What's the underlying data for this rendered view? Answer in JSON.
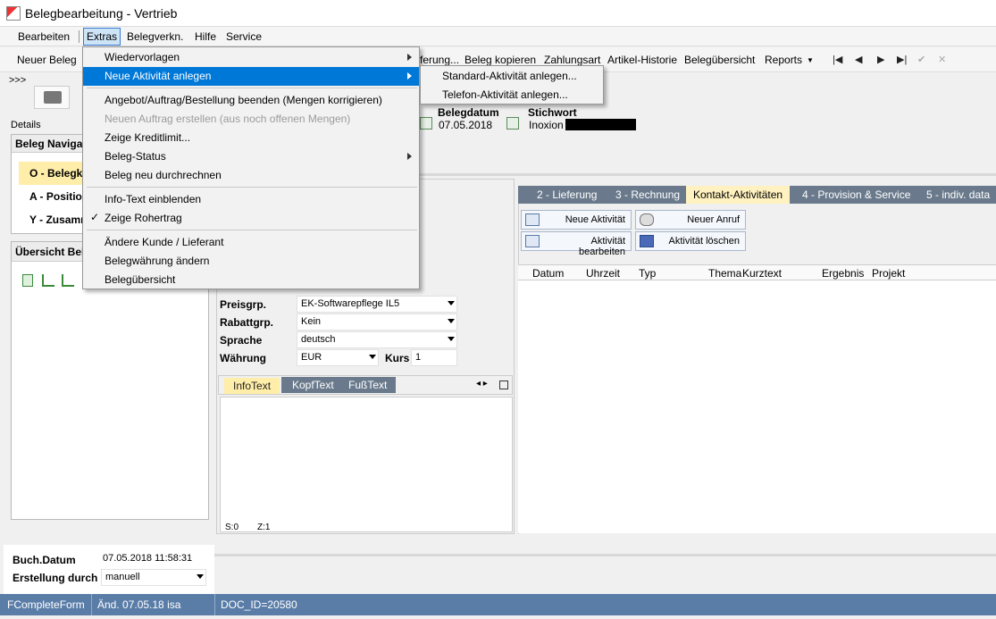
{
  "window": {
    "title": "Belegbearbeitung - Vertrieb"
  },
  "menubar": {
    "items": [
      "Bearbeiten",
      "Extras",
      "Belegverkn.",
      "Hilfe",
      "Service"
    ]
  },
  "toolbar": {
    "new_doc": "Neuer Beleg",
    "items_right": [
      "ferung...",
      "Beleg kopieren",
      "Zahlungsart",
      "Artikel-Historie",
      "Belegübersicht",
      "Reports"
    ],
    "nav": [
      "|◀",
      "◀",
      "▶",
      "▶|",
      "✔",
      "✕"
    ]
  },
  "left": {
    "expander": ">>>",
    "details_label": "Details",
    "nav_header": "Beleg Navigat",
    "nav_items": [
      "O - Belegk",
      "A - Position",
      "Y - Zusamı"
    ],
    "overview_header": "Übersicht Bel"
  },
  "header_fields": {
    "date_label": "Belegdatum",
    "date_value": "07.05.2018",
    "keyword_label": "Stichwort",
    "keyword_value": "Inoxion"
  },
  "tabs": [
    "2 - Lieferung",
    "3 - Rechnung",
    "Kontakt-Aktivitäten",
    "4 - Provision & Service",
    "5 - indiv. data"
  ],
  "activity_buttons": {
    "new_activity": "Neue Aktivität",
    "new_call": "Neuer Anruf",
    "edit_activity": "Aktivität bearbeiten",
    "delete_activity": "Aktivität löschen"
  },
  "grid_columns": [
    "Datum",
    "Uhrzeit",
    "Typ",
    "Thema",
    "Kurztext",
    "Ergebnis",
    "Projekt"
  ],
  "form": {
    "price_group_label": "Preisgrp.",
    "price_group_value": "EK-Softwarepflege IL5",
    "discount_label": "Rabattgrp.",
    "discount_value": "Kein",
    "language_label": "Sprache",
    "language_value": "deutsch",
    "currency_label": "Währung",
    "currency_value": "EUR",
    "rate_label": "Kurs",
    "rate_value": "1"
  },
  "info_tabs": [
    "InfoText",
    "KopfText",
    "FußText"
  ],
  "info_status": {
    "s": "S:0",
    "z": "Z:1"
  },
  "bottom": {
    "booking_label": "Buch.Datum",
    "booking_value": "07.05.2018 11:58:31",
    "created_label": "Erstellung durch",
    "created_value": "manuell"
  },
  "statusbar": [
    "FCompleteForm",
    "Änd. 07.05.18 isa",
    "DOC_ID=20580"
  ],
  "dropdown": {
    "items": [
      "Wiedervorlagen",
      "Neue Aktivität anlegen",
      "Angebot/Auftrag/Bestellung beenden (Mengen korrigieren)",
      "Neuen Auftrag erstellen (aus noch offenen Mengen)",
      "Zeige Kreditlimit...",
      "Beleg-Status",
      "Beleg neu durchrechnen",
      "Info-Text einblenden",
      "Zeige Rohertrag",
      "Ändere Kunde / Lieferant",
      "Belegwährung ändern",
      "Belegübersicht"
    ]
  },
  "submenu": {
    "items": [
      "Standard-Aktivität anlegen...",
      "Telefon-Aktivität anlegen..."
    ]
  },
  "colors": {
    "accent": "#0078d7",
    "statusbar": "#5a7da8",
    "tab_selected": "#fff2c0",
    "nav_selected": "#ffeeaa"
  }
}
